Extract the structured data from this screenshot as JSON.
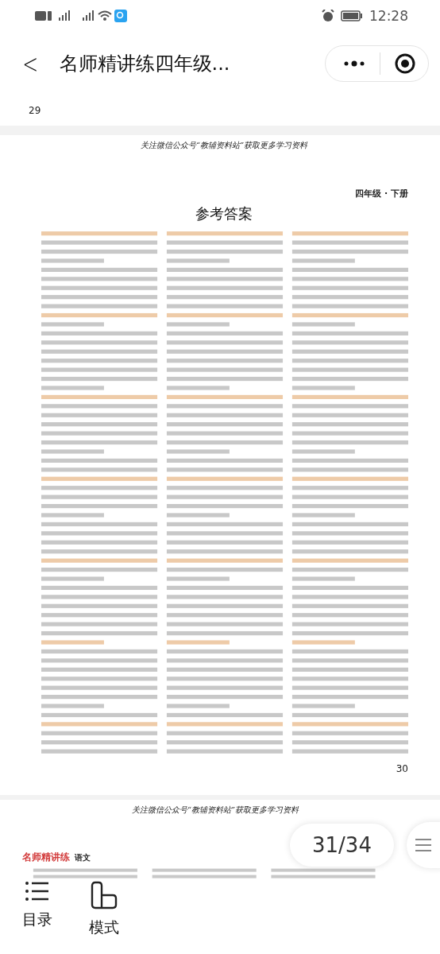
{
  "status_bar": {
    "time": "12:28"
  },
  "title_bar": {
    "back": "<",
    "title": "名师精讲练四年级..."
  },
  "prev_page": {
    "page_number": "29"
  },
  "page": {
    "banner": "关注微信公众号“教辅资料站”获取更多学习资料",
    "grade": "四年级 · 下册",
    "heading": "参考答案",
    "page_number": "30"
  },
  "next_page": {
    "banner": "关注微信公众号“教辅资料站”获取更多学习资料",
    "brand": "名师精讲练",
    "subject": "语文"
  },
  "page_indicator": "31/34",
  "bottom_nav": [
    {
      "label": "目录",
      "kind": "list"
    },
    {
      "label": "模式",
      "kind": "mode"
    }
  ]
}
